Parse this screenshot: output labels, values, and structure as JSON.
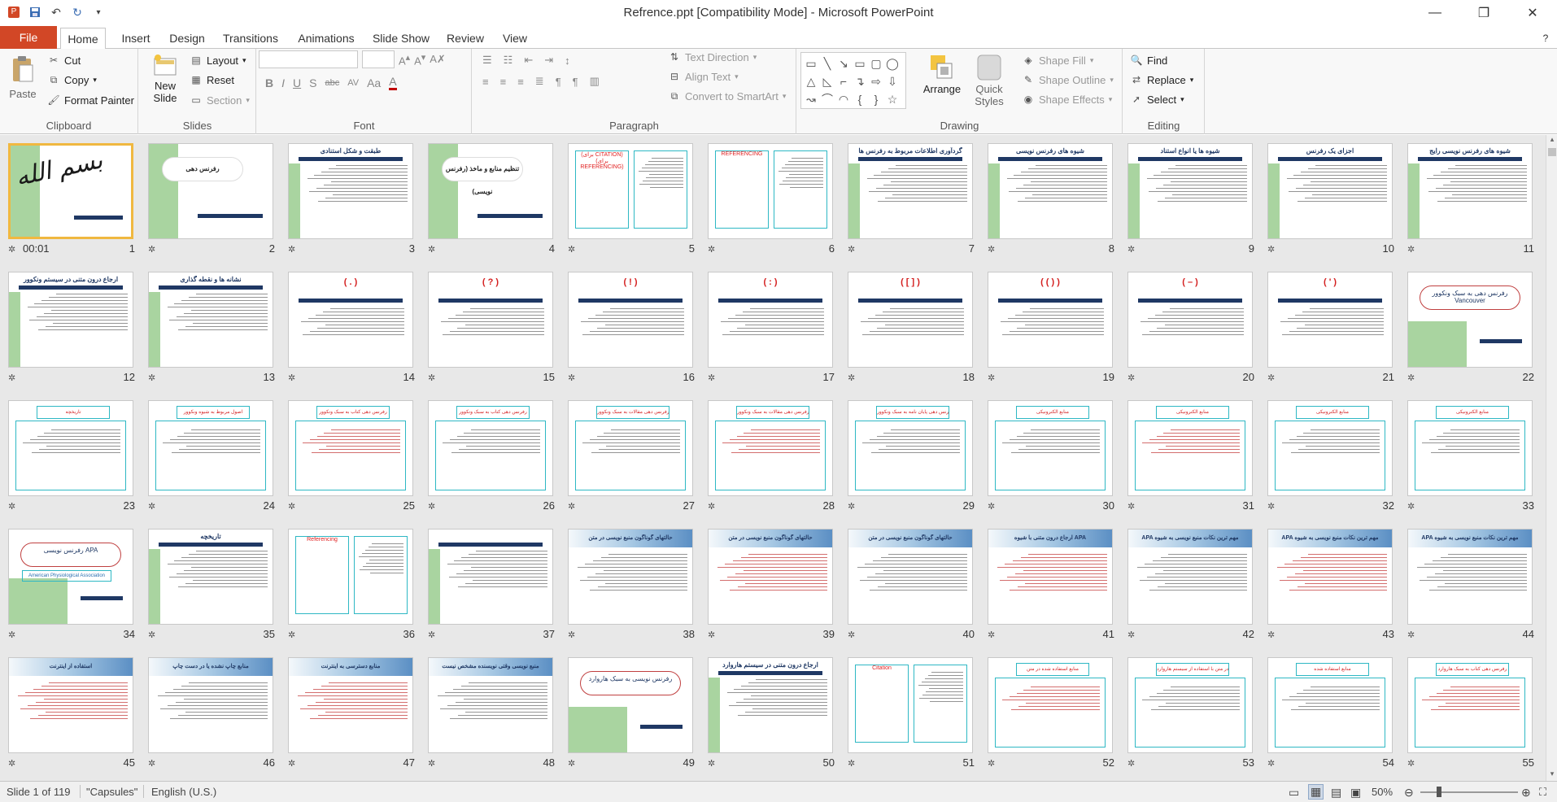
{
  "window": {
    "title": "Refrence.ppt [Compatibility Mode]  -  Microsoft PowerPoint",
    "qat": [
      "app-icon",
      "save-icon",
      "undo-icon",
      "redo-icon",
      "customize-icon"
    ],
    "controls": [
      "—",
      "❐",
      "✕"
    ]
  },
  "tabs": {
    "file": "File",
    "items": [
      "Home",
      "Insert",
      "Design",
      "Transitions",
      "Animations",
      "Slide Show",
      "Review",
      "View"
    ],
    "active": "Home"
  },
  "ribbon": {
    "clipboard": {
      "label": "Clipboard",
      "paste": "Paste",
      "cut": "Cut",
      "copy": "Copy",
      "format_painter": "Format Painter"
    },
    "slides": {
      "label": "Slides",
      "new_slide": "New Slide",
      "layout": "Layout",
      "reset": "Reset",
      "section": "Section"
    },
    "font": {
      "label": "Font",
      "font_name": "",
      "font_size": "",
      "buttons": [
        "B",
        "I",
        "U",
        "S",
        "abc",
        "AV",
        "Aa",
        "A"
      ]
    },
    "paragraph": {
      "label": "Paragraph",
      "text_direction": "Text Direction",
      "align_text": "Align Text",
      "smartart": "Convert to SmartArt"
    },
    "drawing": {
      "label": "Drawing",
      "arrange": "Arrange",
      "quick_styles": "Quick Styles",
      "shape_fill": "Shape Fill",
      "shape_outline": "Shape Outline",
      "shape_effects": "Shape Effects"
    },
    "editing": {
      "label": "Editing",
      "find": "Find",
      "replace": "Replace",
      "select": "Select"
    }
  },
  "sorter": {
    "first_slide_time": "00:01",
    "slides": [
      {
        "n": "1",
        "k": "calli"
      },
      {
        "n": "2",
        "k": "title",
        "t": "رفرنس دهی"
      },
      {
        "n": "3",
        "k": "text",
        "t": "طبقت و شکل استنادی"
      },
      {
        "n": "4",
        "k": "title",
        "t": "تنظیم منابع و ماخذ (رفرنس نویسی)"
      },
      {
        "n": "5",
        "k": "boxes",
        "t": "(برای CITATION)  (برای REFERENCING)"
      },
      {
        "n": "6",
        "k": "boxes2",
        "t": "REFERENCING"
      },
      {
        "n": "7",
        "k": "text",
        "t": "گردآوری اطلاعات مربوط به رفرنس ها"
      },
      {
        "n": "8",
        "k": "text",
        "t": "شیوه های رفرنس نویسی"
      },
      {
        "n": "9",
        "k": "text",
        "t": "شیوه ها یا انواع استناد"
      },
      {
        "n": "10",
        "k": "text",
        "t": "اجزای یک رفرنس"
      },
      {
        "n": "11",
        "k": "text",
        "t": "شیوه های رفرنس نویسی رایج"
      },
      {
        "n": "12",
        "k": "text",
        "t": "ارجاع درون متنی در سیستم ونکوور"
      },
      {
        "n": "13",
        "k": "text",
        "t": "نشانه ها و نقطه گذاری"
      },
      {
        "n": "14",
        "k": "paren",
        "t": "( . )"
      },
      {
        "n": "15",
        "k": "paren",
        "t": "( ? )"
      },
      {
        "n": "16",
        "k": "paren",
        "t": "( ! )"
      },
      {
        "n": "17",
        "k": "paren",
        "t": "( : )"
      },
      {
        "n": "18",
        "k": "paren",
        "t": "( [ ] )"
      },
      {
        "n": "19",
        "k": "paren",
        "t": "( ( ) )"
      },
      {
        "n": "20",
        "k": "paren",
        "t": "( – )"
      },
      {
        "n": "21",
        "k": "paren",
        "t": "( ' )"
      },
      {
        "n": "22",
        "k": "pill",
        "t": "رفرنس دهی به سبک ونکوور Vancouver"
      },
      {
        "n": "23",
        "k": "heading",
        "t": "تاریخچه"
      },
      {
        "n": "24",
        "k": "heading",
        "t": "اصول مربوط به شیوه ونکوور"
      },
      {
        "n": "25",
        "k": "heading",
        "t": "رفرنس دهی کتاب به سبک ونکوور"
      },
      {
        "n": "26",
        "k": "heading",
        "t": "رفرنس دهی کتاب به سبک ونکوور"
      },
      {
        "n": "27",
        "k": "heading",
        "t": "رفرنس دهی مقالات به سبک ونکوور"
      },
      {
        "n": "28",
        "k": "heading",
        "t": "رفرنس دهی مقالات به سبک ونکوور"
      },
      {
        "n": "29",
        "k": "heading",
        "t": "رفرنس دهی پایان نامه به سبک ونکوور"
      },
      {
        "n": "30",
        "k": "heading",
        "t": "منابع الکترونیکی"
      },
      {
        "n": "31",
        "k": "heading",
        "t": "منابع الکترونیکی"
      },
      {
        "n": "32",
        "k": "heading",
        "t": "منابع الکترونیکی"
      },
      {
        "n": "33",
        "k": "heading",
        "t": "منابع الکترونیکی"
      },
      {
        "n": "34",
        "k": "pill2",
        "t": "رفرنس نویسی APA",
        "sub": "American Physiological Association"
      },
      {
        "n": "35",
        "k": "text",
        "t": "تاریخچه"
      },
      {
        "n": "36",
        "k": "boxes2",
        "t": "Referencing"
      },
      {
        "n": "37",
        "k": "text",
        "t": ""
      },
      {
        "n": "38",
        "k": "band",
        "t": "حالتهای گوناگون منبع نویسی در متن"
      },
      {
        "n": "39",
        "k": "band",
        "t": "حالتهای گوناگون منبع نویسی در متن"
      },
      {
        "n": "40",
        "k": "band",
        "t": "حالتهای گوناگون منبع نویسی در متن"
      },
      {
        "n": "41",
        "k": "band",
        "t": "ارجاع درون متنی با شیوه APA"
      },
      {
        "n": "42",
        "k": "band",
        "t": "APA مهم ترین نکات منبع نویسی به شیوه"
      },
      {
        "n": "43",
        "k": "band",
        "t": "APA مهم ترین نکات منبع نویسی به شیوه"
      },
      {
        "n": "44",
        "k": "band",
        "t": "APA مهم ترین نکات منبع نویسی به شیوه"
      },
      {
        "n": "45",
        "k": "band",
        "t": "استفاده از اینترنت"
      },
      {
        "n": "46",
        "k": "band",
        "t": "منابع چاپ نشده یا در دست چاپ"
      },
      {
        "n": "47",
        "k": "band",
        "t": "منابع دسترسی به اینترنت"
      },
      {
        "n": "48",
        "k": "band",
        "t": "منبع نویسی وقتی نویسنده مشخص نیست"
      },
      {
        "n": "49",
        "k": "pill",
        "t": "رفرنس نویسی به سبک هاروارد"
      },
      {
        "n": "50",
        "k": "text",
        "t": "ارجاع درون متنی در سیستم هاروارد"
      },
      {
        "n": "51",
        "k": "boxes2",
        "t": "Citation"
      },
      {
        "n": "52",
        "k": "heading",
        "t": "منابع استفاده شده در متن"
      },
      {
        "n": "53",
        "k": "heading",
        "t": "منابع استفاده شده در متن با استفاده از سیستم هاروارد"
      },
      {
        "n": "54",
        "k": "heading",
        "t": "منابع استفاده شده"
      },
      {
        "n": "55",
        "k": "heading",
        "t": "رفرنس دهی کتاب به سبک هاروارد"
      }
    ]
  },
  "statusbar": {
    "slide_info": "Slide 1 of 119",
    "theme": "\"Capsules\"",
    "language": "English (U.S.)",
    "zoom": "50%"
  }
}
